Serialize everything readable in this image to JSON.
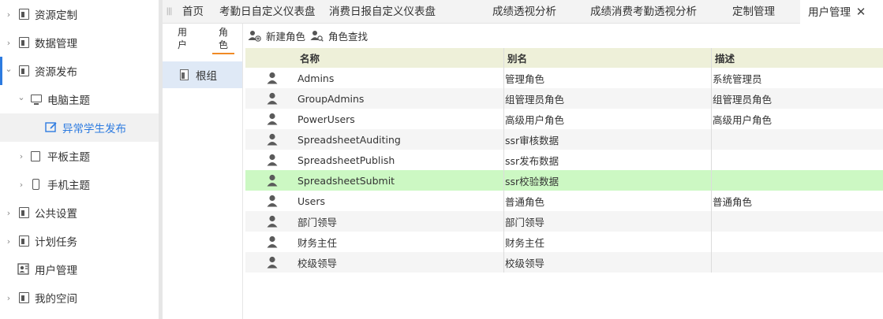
{
  "sidebar": {
    "items": [
      {
        "label": "资源定制",
        "caret": "›"
      },
      {
        "label": "数据管理",
        "caret": "›"
      },
      {
        "label": "资源发布",
        "caret": "⌄"
      },
      {
        "label": "电脑主题",
        "caret": "⌄"
      },
      {
        "label": "异常学生发布",
        "caret": ""
      },
      {
        "label": "平板主题",
        "caret": "›"
      },
      {
        "label": "手机主题",
        "caret": "›"
      },
      {
        "label": "公共设置",
        "caret": "›"
      },
      {
        "label": "计划任务",
        "caret": "›"
      },
      {
        "label": "用户管理",
        "caret": ""
      },
      {
        "label": "我的空间",
        "caret": "›"
      }
    ]
  },
  "tabs": {
    "handle": "|||",
    "items": [
      {
        "label": "首页"
      },
      {
        "label": "考勤日自定义仪表盘"
      },
      {
        "label": "消费日报自定义仪表盘"
      },
      {
        "label": "成绩透视分析"
      },
      {
        "label": "成绩消费考勤透视分析"
      },
      {
        "label": "定制管理"
      },
      {
        "label": "用户管理"
      }
    ],
    "close_glyph": "✕"
  },
  "subpanel": {
    "user_tab": "用\n户",
    "role_tab": "角\n色",
    "tree_root": "根组"
  },
  "toolbar": {
    "new_role": "新建角色",
    "find_role": "角色查找"
  },
  "grid": {
    "columns": [
      "名称",
      "别名",
      "描述"
    ],
    "rows": [
      {
        "name": "Admins",
        "alias": "管理角色",
        "desc": "系统管理员"
      },
      {
        "name": "GroupAdmins",
        "alias": "组管理员角色",
        "desc": "组管理员角色"
      },
      {
        "name": "PowerUsers",
        "alias": "高级用户角色",
        "desc": "高级用户角色"
      },
      {
        "name": "SpreadsheetAuditing",
        "alias": "ssr审核数据",
        "desc": ""
      },
      {
        "name": "SpreadsheetPublish",
        "alias": "ssr发布数据",
        "desc": ""
      },
      {
        "name": "SpreadsheetSubmit",
        "alias": "ssr校验数据",
        "desc": ""
      },
      {
        "name": "Users",
        "alias": "普通角色",
        "desc": "普通角色"
      },
      {
        "name": "部门领导",
        "alias": "部门领导",
        "desc": ""
      },
      {
        "name": "财务主任",
        "alias": "财务主任",
        "desc": ""
      },
      {
        "name": "校级领导",
        "alias": "校级领导",
        "desc": ""
      }
    ]
  },
  "colors": {
    "accent": "#2d7be0",
    "orange_underline": "#f08a24",
    "selected_row": "#ccf8c3",
    "header_bg": "#eef0d9"
  }
}
